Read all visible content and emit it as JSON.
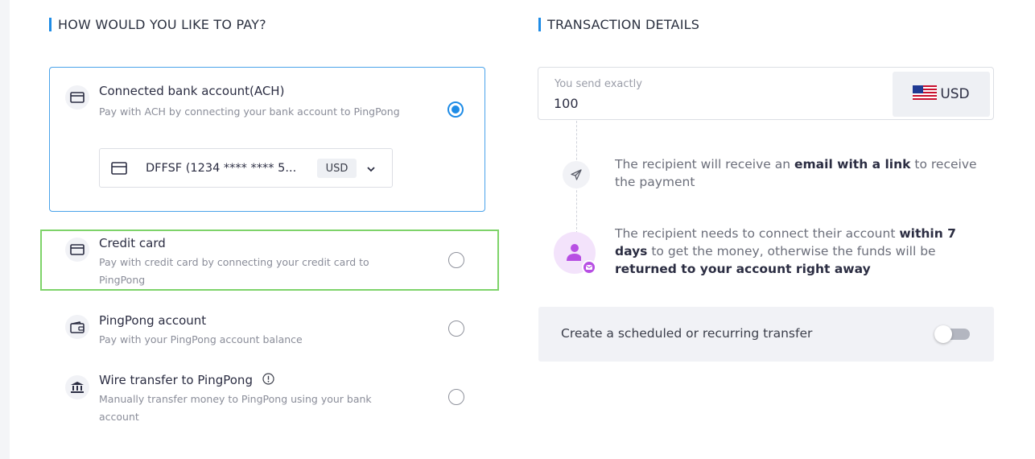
{
  "left_section": {
    "title": "HOW WOULD YOU LIKE TO PAY?"
  },
  "right_section": {
    "title": "TRANSACTION DETAILS"
  },
  "payment_options": [
    {
      "title": "Connected bank account(ACH)",
      "description": "Pay with ACH by connecting your bank account to PingPong",
      "icon": "card-icon",
      "selected": true,
      "bank_account": {
        "label": "DFFSF (1234 **** **** 5...",
        "currency": "USD"
      }
    },
    {
      "title": "Credit card",
      "description": "Pay with credit card by connecting your credit card to PingPong",
      "icon": "card-icon",
      "selected": false
    },
    {
      "title": "PingPong account",
      "description": "Pay with your PingPong account balance",
      "icon": "wallet-icon",
      "selected": false
    },
    {
      "title": "Wire transfer to PingPong",
      "description": "Manually transfer money to PingPong using your bank account",
      "icon": "bank-icon",
      "selected": false
    }
  ],
  "send": {
    "label": "You send exactly",
    "amount": "100",
    "currency": "USD",
    "flag": "us-flag-icon"
  },
  "info": {
    "email_note": {
      "pre": "The recipient will receive an ",
      "bold": "email with a link",
      "post": " to receive the payment"
    },
    "connect_note": {
      "pre": "The recipient needs to connect their account ",
      "bold1": "within 7 days",
      "mid": " to get the money, otherwise the funds will be ",
      "bold2": "returned to your account right away"
    }
  },
  "schedule": {
    "label": "Create a scheduled or recurring transfer",
    "enabled": false
  },
  "colors": {
    "accent": "#1f8ce6",
    "highlight": "#7ed36a",
    "avatar": "#b74fe3"
  }
}
